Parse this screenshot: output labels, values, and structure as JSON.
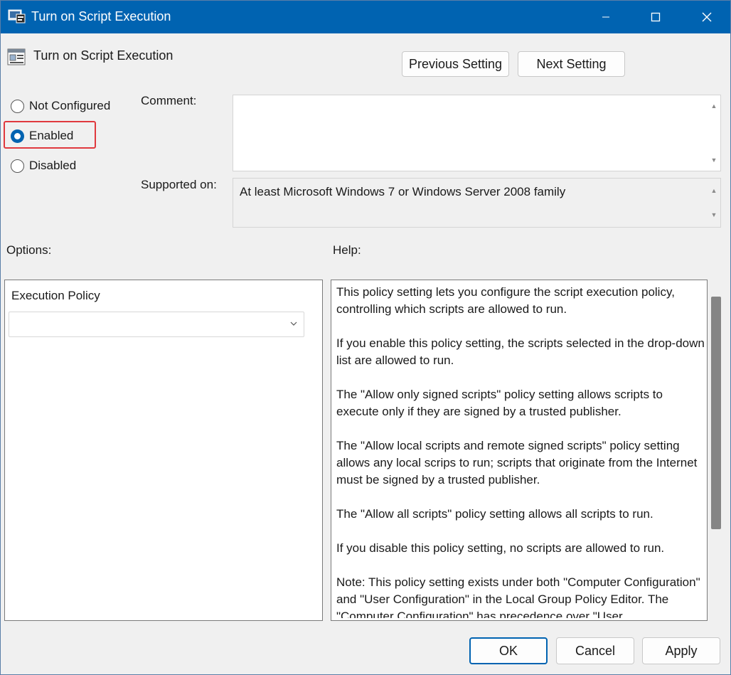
{
  "window": {
    "title": "Turn on Script Execution",
    "controls": [
      "minimize-icon",
      "maximize-icon",
      "close-icon"
    ]
  },
  "header": {
    "policy_title": "Turn on Script Execution",
    "previous_label": "Previous Setting",
    "next_label": "Next Setting"
  },
  "state": {
    "options": [
      {
        "label": "Not Configured",
        "checked": false
      },
      {
        "label": "Enabled",
        "checked": true
      },
      {
        "label": "Disabled",
        "checked": false
      }
    ]
  },
  "comment": {
    "label": "Comment:",
    "value": ""
  },
  "supported": {
    "label": "Supported on:",
    "value": "At least Microsoft Windows 7 or Windows Server 2008 family"
  },
  "options_panel": {
    "label": "Options:",
    "execution_policy_label": "Execution Policy",
    "execution_policy_value": ""
  },
  "help_panel": {
    "label": "Help:",
    "paragraphs": [
      "This policy setting lets you configure the script execution policy, controlling which scripts are allowed to run.",
      "If you enable this policy setting, the scripts selected in the drop-down list are allowed to run.",
      "The \"Allow only signed scripts\" policy setting allows scripts to execute only if they are signed by a trusted publisher.",
      "The \"Allow local scripts and remote signed scripts\" policy setting allows any local scrips to run; scripts that originate from the Internet must be signed by a trusted publisher.",
      "The \"Allow all scripts\" policy setting allows all scripts to run.",
      "If you disable this policy setting, no scripts are allowed to run.",
      "Note: This policy setting exists under both \"Computer Configuration\" and \"User Configuration\" in the Local Group Policy Editor. The \"Computer Configuration\" has precedence over \"User"
    ]
  },
  "footer": {
    "ok_label": "OK",
    "cancel_label": "Cancel",
    "apply_label": "Apply"
  },
  "colors": {
    "accent": "#0063b1",
    "highlight": "#e0393e"
  }
}
